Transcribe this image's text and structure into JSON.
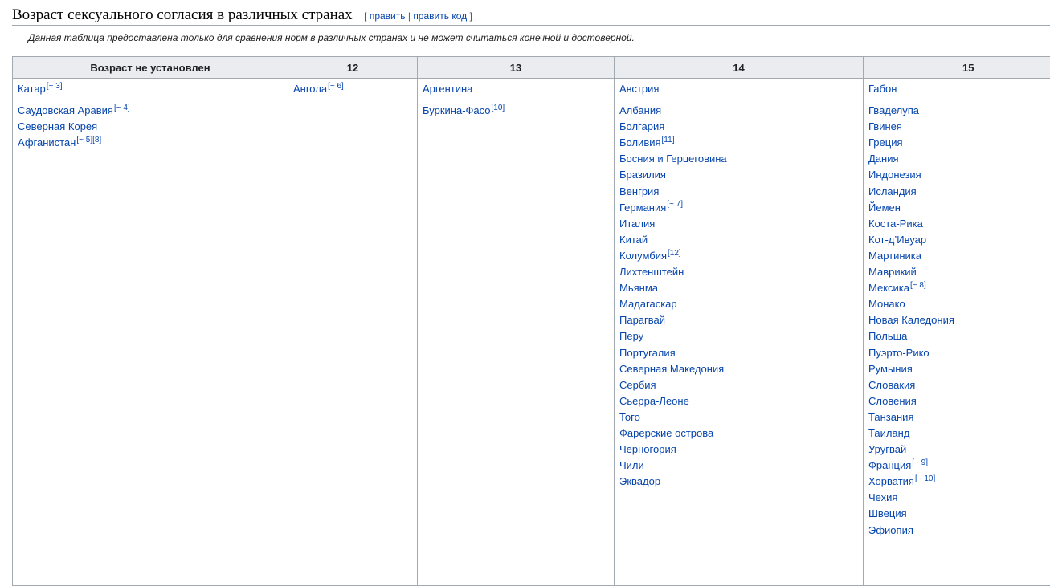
{
  "heading": {
    "title": "Возраст сексуального согласия в различных странах",
    "edit_open": "[",
    "edit_link": "править",
    "edit_sep": "|",
    "edit_code_link": "править код",
    "edit_close": "]"
  },
  "note": "Данная таблица предоставлена только для сравнения норм в различных странах и не может считаться конечной и достоверной.",
  "table": {
    "headers": [
      "Возраст не установлен",
      "12",
      "13",
      "14",
      "15"
    ],
    "columns": [
      [
        {
          "name": "Катар",
          "ref": "[~ 3]",
          "gap": true
        },
        {
          "name": "Саудовская Аравия",
          "ref": "[~ 4]"
        },
        {
          "name": "Северная Корея"
        },
        {
          "name": "Афганистан",
          "ref": "[~ 5][8]"
        }
      ],
      [
        {
          "name": "Ангола",
          "ref": "[~ 6]"
        }
      ],
      [
        {
          "name": "Аргентина",
          "gap": true
        },
        {
          "name": "Буркина-Фасо",
          "ref": "[10]"
        }
      ],
      [
        {
          "name": "Австрия",
          "gap": true
        },
        {
          "name": "Албания"
        },
        {
          "name": "Болгария"
        },
        {
          "name": "Боливия",
          "ref": "[11]"
        },
        {
          "name": "Босния и Герцеговина"
        },
        {
          "name": "Бразилия"
        },
        {
          "name": "Венгрия"
        },
        {
          "name": "Германия",
          "ref": "[~ 7]"
        },
        {
          "name": "Италия"
        },
        {
          "name": "Китай"
        },
        {
          "name": "Колумбия",
          "ref": "[12]"
        },
        {
          "name": "Лихтенштейн"
        },
        {
          "name": "Мьянма"
        },
        {
          "name": "Мадагаскар"
        },
        {
          "name": "Парагвай"
        },
        {
          "name": "Перу"
        },
        {
          "name": "Португалия"
        },
        {
          "name": "Северная Македония"
        },
        {
          "name": "Сербия"
        },
        {
          "name": "Сьерра-Леоне"
        },
        {
          "name": "Того"
        },
        {
          "name": "Фарерские острова"
        },
        {
          "name": "Черногория"
        },
        {
          "name": "Чили"
        },
        {
          "name": "Эквадор"
        }
      ],
      [
        {
          "name": "Габон",
          "gap": true
        },
        {
          "name": "Гваделупа"
        },
        {
          "name": "Гвинея"
        },
        {
          "name": "Греция"
        },
        {
          "name": "Дания"
        },
        {
          "name": "Индонезия"
        },
        {
          "name": "Исландия"
        },
        {
          "name": "Йемен"
        },
        {
          "name": "Коста-Рика"
        },
        {
          "name": "Кот-д’Ивуар"
        },
        {
          "name": "Мартиника"
        },
        {
          "name": "Маврикий"
        },
        {
          "name": "Мексика",
          "ref": "[~ 8]"
        },
        {
          "name": "Монако"
        },
        {
          "name": "Новая Каледония"
        },
        {
          "name": "Польша"
        },
        {
          "name": "Пуэрто-Рико"
        },
        {
          "name": "Румыния"
        },
        {
          "name": "Словакия"
        },
        {
          "name": "Словения"
        },
        {
          "name": "Танзания"
        },
        {
          "name": "Таиланд"
        },
        {
          "name": "Уругвай"
        },
        {
          "name": "Франция",
          "ref": "[~ 9]"
        },
        {
          "name": "Хорватия",
          "ref": "[~ 10]"
        },
        {
          "name": "Чехия"
        },
        {
          "name": "Швеция"
        },
        {
          "name": "Эфиопия"
        }
      ]
    ]
  }
}
